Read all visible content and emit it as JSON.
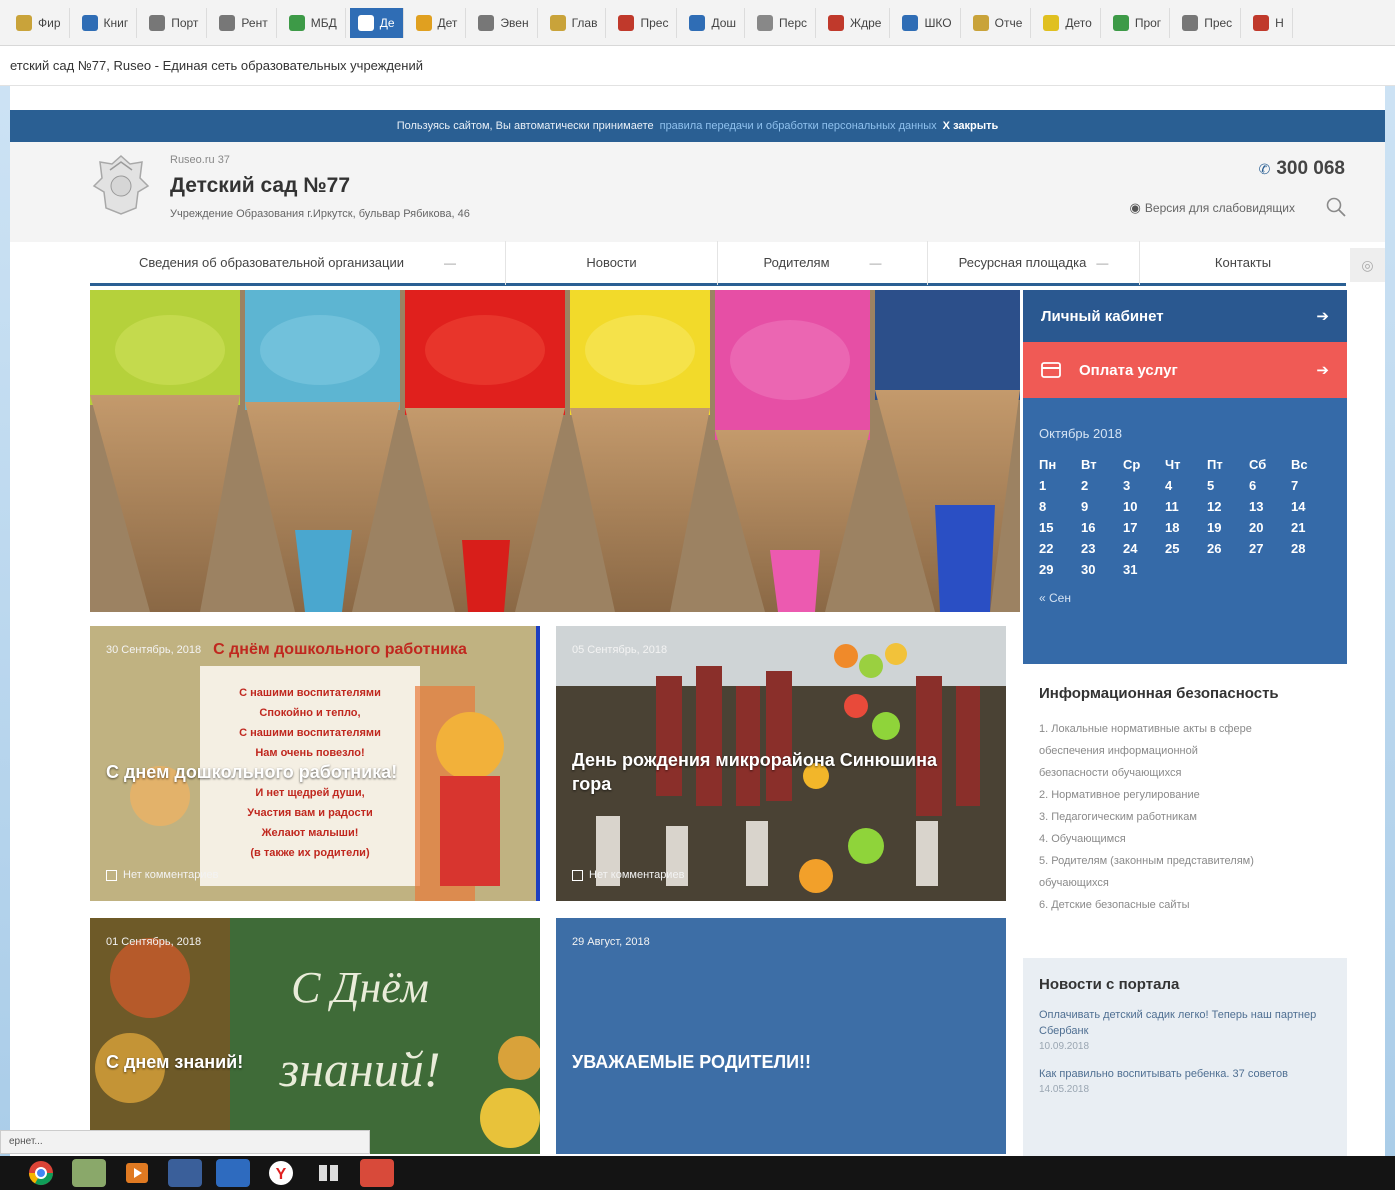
{
  "bookmarks": [
    {
      "label": "Фир",
      "color": "#c9a33a"
    },
    {
      "label": "Книг",
      "color": "#2f6db5"
    },
    {
      "label": "Порт",
      "color": "#777777"
    },
    {
      "label": "Рент",
      "color": "#777777"
    },
    {
      "label": "МБД",
      "color": "#3d9a47"
    },
    {
      "label": "Де",
      "color": "#ffffff",
      "active": true
    },
    {
      "label": "Дет",
      "color": "#e0a020"
    },
    {
      "label": "Эвен",
      "color": "#777777"
    },
    {
      "label": "Глав",
      "color": "#c9a33a"
    },
    {
      "label": "Прес",
      "color": "#c0392b"
    },
    {
      "label": "Дош",
      "color": "#2f6db5"
    },
    {
      "label": "Перс",
      "color": "#888888"
    },
    {
      "label": "Ждре",
      "color": "#c0392b"
    },
    {
      "label": "ШКО",
      "color": "#2f6db5"
    },
    {
      "label": "Отче",
      "color": "#c9a33a"
    },
    {
      "label": "Дето",
      "color": "#e0c020"
    },
    {
      "label": "Прог",
      "color": "#3d9a47"
    },
    {
      "label": "Прес",
      "color": "#777777"
    },
    {
      "label": "Н",
      "color": "#c0392b"
    }
  ],
  "browser": {
    "page_title": "етский сад №77, Ruseo - Единая сеть образовательных учреждений"
  },
  "cookie": {
    "text": "Пользуясь сайтом, Вы автоматически принимаете",
    "link": "правила передачи и обработки персональных данных",
    "close": "X закрыть"
  },
  "header": {
    "site_small": "Ruseo.ru 37",
    "site_name": "Детский сад №77",
    "subtitle": "Учреждение Образования  г.Иркутск, бульвар Рябикова, 46",
    "phone": "300 068",
    "low_vision": "Версия для слабовидящих"
  },
  "nav": [
    {
      "label": "Сведения об образовательной организации",
      "dropdown": true
    },
    {
      "label": "Новости",
      "dropdown": false
    },
    {
      "label": "Родителям",
      "dropdown": true
    },
    {
      "label": "Ресурсная площадка",
      "dropdown": true
    },
    {
      "label": "Контакты",
      "dropdown": false
    }
  ],
  "cards": [
    {
      "date": "30 Сентябрь, 2018",
      "title": "С днем дошкольного работника!",
      "comments": "Нет комментариев"
    },
    {
      "date": "05 Сентябрь, 2018",
      "title": "День рождения микрорайона Синюшина гора",
      "comments": "Нет комментариев"
    },
    {
      "date": "01 Сентябрь, 2018",
      "title": "С днем знаний!",
      "comments": ""
    },
    {
      "date": "29 Август, 2018",
      "title": "УВАЖАЕМЫЕ РОДИТЕЛИ!!",
      "comments": ""
    }
  ],
  "sidebar": {
    "cabinet": "Личный кабинет",
    "payment": "Оплата услуг",
    "calendar": {
      "month": "Октябрь 2018",
      "days_header": [
        "Пн",
        "Вт",
        "Ср",
        "Чт",
        "Пт",
        "Сб",
        "Вс"
      ],
      "days": [
        "1",
        "2",
        "3",
        "4",
        "5",
        "6",
        "7",
        "8",
        "9",
        "10",
        "11",
        "12",
        "13",
        "14",
        "15",
        "16",
        "17",
        "18",
        "19",
        "20",
        "21",
        "22",
        "23",
        "24",
        "25",
        "26",
        "27",
        "28",
        "29",
        "30",
        "31"
      ],
      "prev": "« Сен"
    },
    "infosec": {
      "title": "Информационная безопасность",
      "items": [
        "1. Локальные нормативные акты в сфере",
        "обеспечения информационной",
        "безопасности обучающихся",
        "2. Нормативное регулирование",
        "3. Педагогическим работникам",
        "4. Обучающимся",
        "5. Родителям (законным представителям)",
        "обучающихся",
        "6. Детские безопасные сайты"
      ]
    },
    "portal": {
      "title": "Новости с портала",
      "items": [
        {
          "text": "Оплачивать детский садик легко! Теперь наш партнер Сбербанк",
          "date": "10.09.2018"
        },
        {
          "text": "Как правильно воспитывать ребенка. 37 советов",
          "date": "14.05.2018"
        }
      ]
    }
  },
  "card4_title_part2": "",
  "card3_chalk": {
    "line1": "С Днём",
    "line2": "знаний!"
  },
  "card1_poster": {
    "banner": "С днём дошкольного работника",
    "lines": [
      "С нашими воспитателями",
      "Спокойно и тепло,",
      "С нашими воспитателями",
      "Нам очень повезло!",
      "И нет щедрей души,",
      "Участия вам и радости",
      "Желают малыши!",
      "(в также их родители)"
    ]
  },
  "status_text": "ернет..."
}
